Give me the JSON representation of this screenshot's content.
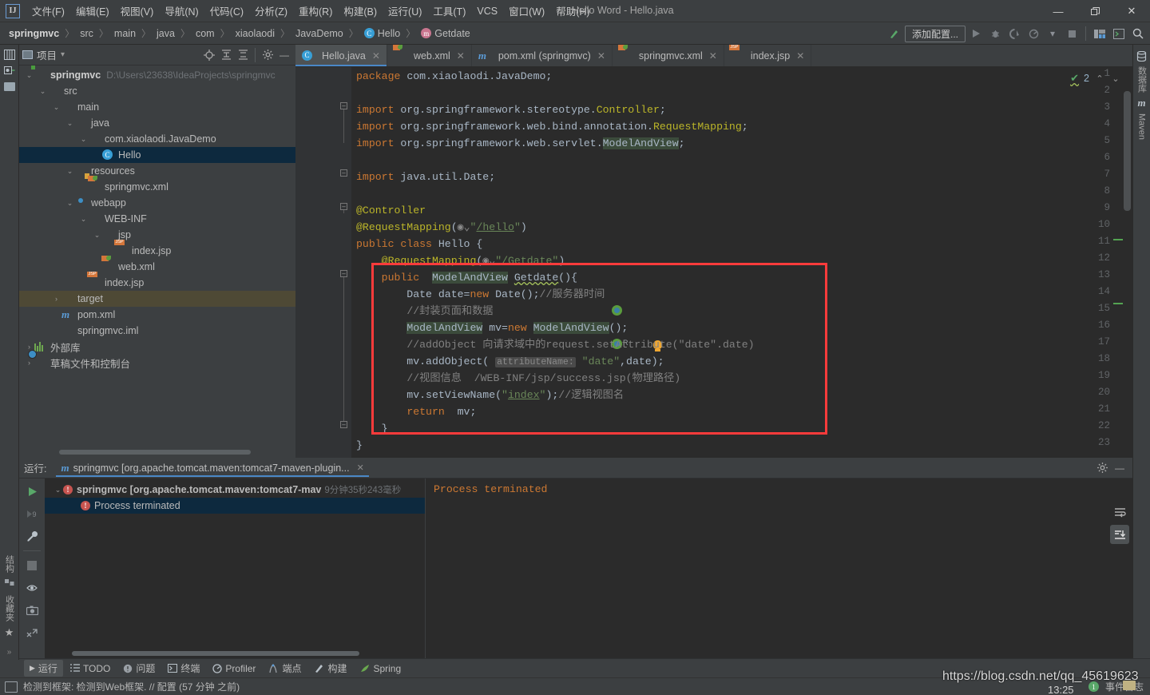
{
  "window": {
    "title": "Hello Word - Hello.java",
    "minimize": "—",
    "maximize": "❐",
    "close": "✕"
  },
  "menu": {
    "logo": "IJ",
    "items": [
      "文件(F)",
      "编辑(E)",
      "视图(V)",
      "导航(N)",
      "代码(C)",
      "分析(Z)",
      "重构(R)",
      "构建(B)",
      "运行(U)",
      "工具(T)",
      "VCS",
      "窗口(W)",
      "帮助(H)"
    ]
  },
  "breadcrumb": {
    "separator": "〉",
    "items": [
      {
        "label": "springmvc",
        "bold": true,
        "badge": ""
      },
      {
        "label": "src",
        "bold": false,
        "badge": ""
      },
      {
        "label": "main",
        "bold": false,
        "badge": ""
      },
      {
        "label": "java",
        "bold": false,
        "badge": ""
      },
      {
        "label": "com",
        "bold": false,
        "badge": ""
      },
      {
        "label": "xiaolaodi",
        "bold": false,
        "badge": ""
      },
      {
        "label": "JavaDemo",
        "bold": false,
        "badge": ""
      },
      {
        "label": "Hello",
        "bold": false,
        "badge": "C"
      },
      {
        "label": "Getdate",
        "bold": false,
        "badge": "m"
      }
    ]
  },
  "nav_toolbar": {
    "build_icon": "build-hammer-icon",
    "add_config_label": "添加配置...",
    "run_icon": "▶",
    "debug_icon": "debug-bug-icon",
    "coverage_icon": "coverage-icon",
    "profile_icon": "profiler-icon",
    "dropdown_icon": "▾",
    "stop_icon": "■",
    "layout_icon": "layout-icon",
    "terminal_icon": "terminal-icon",
    "search_icon": "⌕"
  },
  "left_strip": {
    "project_icon": "project-window-icon",
    "commit_icon": "commit-icon",
    "folder_icon": "folder-icon",
    "structure_label": "结构",
    "bookmarks_icon": "bookmarks-icon",
    "favorites_label": "收藏夹",
    "star_icon": "★"
  },
  "right_strip": {
    "database_label": "数据库",
    "database_icon": "database-icon",
    "maven_label": "Maven",
    "maven_icon": "m"
  },
  "project_panel": {
    "title": "项目",
    "dropdown": "▾",
    "icons": {
      "locate": "target-icon",
      "expand": "expand-all-icon",
      "collapse": "collapse-all-icon",
      "settings": "gear-icon",
      "hide": "—"
    },
    "tree": [
      {
        "depth": 0,
        "arrow": "⌄",
        "icon": "module-folder-icon",
        "label": "springmvc",
        "bold": true,
        "path": "D:\\Users\\23638\\IdeaProjects\\springmvc",
        "state": "normal"
      },
      {
        "depth": 1,
        "arrow": "⌄",
        "icon": "folder-icon",
        "label": "src",
        "bold": false,
        "path": "",
        "state": "normal"
      },
      {
        "depth": 2,
        "arrow": "⌄",
        "icon": "folder-icon",
        "label": "main",
        "bold": false,
        "path": "",
        "state": "normal"
      },
      {
        "depth": 3,
        "arrow": "⌄",
        "icon": "source-folder-icon",
        "label": "java",
        "bold": false,
        "path": "",
        "state": "normal"
      },
      {
        "depth": 4,
        "arrow": "⌄",
        "icon": "package-icon",
        "label": "com.xiaolaodi.JavaDemo",
        "bold": false,
        "path": "",
        "state": "normal"
      },
      {
        "depth": 5,
        "arrow": "",
        "icon": "class-icon",
        "label": "Hello",
        "bold": false,
        "path": "",
        "state": "selected"
      },
      {
        "depth": 3,
        "arrow": "⌄",
        "icon": "resources-folder-icon",
        "label": "resources",
        "bold": false,
        "path": "",
        "state": "normal"
      },
      {
        "depth": 4,
        "arrow": "",
        "icon": "spring-xml-icon",
        "label": "springmvc.xml",
        "bold": false,
        "path": "",
        "state": "normal"
      },
      {
        "depth": 3,
        "arrow": "⌄",
        "icon": "webapp-folder-icon",
        "label": "webapp",
        "bold": false,
        "path": "",
        "state": "normal"
      },
      {
        "depth": 4,
        "arrow": "⌄",
        "icon": "folder-icon",
        "label": "WEB-INF",
        "bold": false,
        "path": "",
        "state": "normal"
      },
      {
        "depth": 5,
        "arrow": "⌄",
        "icon": "folder-icon",
        "label": "jsp",
        "bold": false,
        "path": "",
        "state": "normal"
      },
      {
        "depth": 6,
        "arrow": "",
        "icon": "jsp-file-icon",
        "label": "index.jsp",
        "bold": false,
        "path": "",
        "state": "normal"
      },
      {
        "depth": 5,
        "arrow": "",
        "icon": "spring-xml-icon",
        "label": "web.xml",
        "bold": false,
        "path": "",
        "state": "normal"
      },
      {
        "depth": 4,
        "arrow": "",
        "icon": "jsp-file-icon",
        "label": "index.jsp",
        "bold": false,
        "path": "",
        "state": "normal"
      },
      {
        "depth": 2,
        "arrow": "›",
        "icon": "target-folder-icon",
        "label": "target",
        "bold": false,
        "path": "",
        "state": "amber"
      },
      {
        "depth": 2,
        "arrow": "",
        "icon": "maven-pom-icon",
        "label": "pom.xml",
        "bold": false,
        "path": "",
        "state": "normal"
      },
      {
        "depth": 2,
        "arrow": "",
        "icon": "iml-file-icon",
        "label": "springmvc.iml",
        "bold": false,
        "path": "",
        "state": "normal"
      },
      {
        "depth": 0,
        "arrow": "›",
        "icon": "library-icon",
        "label": "外部库",
        "bold": false,
        "path": "",
        "state": "normal"
      },
      {
        "depth": 0,
        "arrow": "›",
        "icon": "scratches-icon",
        "label": "草稿文件和控制台",
        "bold": false,
        "path": "",
        "state": "normal"
      }
    ]
  },
  "editor": {
    "tabs": [
      {
        "label": "Hello.java",
        "icon": "class-icon",
        "active": true,
        "close": "✕"
      },
      {
        "label": "web.xml",
        "icon": "spring-xml-icon",
        "active": false,
        "close": "✕"
      },
      {
        "label": "pom.xml (springmvc)",
        "icon": "maven-pom-icon",
        "active": false,
        "close": "✕"
      },
      {
        "label": "springmvc.xml",
        "icon": "spring-xml-icon",
        "active": false,
        "close": "✕"
      },
      {
        "label": "index.jsp",
        "icon": "jsp-file-icon",
        "active": false,
        "close": "✕"
      }
    ],
    "inspection": {
      "check_icon": "✔",
      "count": "2",
      "up_arrow": "⌃",
      "down_arrow": "⌄"
    },
    "line_numbers": [
      "1",
      "2",
      "3",
      "4",
      "5",
      "6",
      "7",
      "8",
      "9",
      "10",
      "11",
      "12",
      "13",
      "14",
      "15",
      "16",
      "17",
      "18",
      "19",
      "20",
      "21",
      "22",
      "23"
    ],
    "lines": [
      "package com.xiaolaodi.JavaDemo;",
      "",
      "import org.springframework.stereotype.Controller;",
      "import org.springframework.web.bind.annotation.RequestMapping;",
      "import org.springframework.web.servlet.ModelAndView;",
      "",
      "import java.util.Date;",
      "",
      "@Controller",
      "@RequestMapping(\"/hello\")",
      "public class Hello {",
      "    @RequestMapping(\"/Getdate\")",
      "    public  ModelAndView Getdate(){",
      "        Date date=new Date();//服务器时间",
      "        //封装页面和数据",
      "        ModelAndView mv=new ModelAndView();",
      "        //addObject 向请求域中的request.setAttribute(\"date\".date)",
      "        mv.addObject( attributeName: \"date\",date);",
      "        //视图信息  /WEB-INF/jsp/success.jsp(物理路径)",
      "        mv.setViewName(\"index\");//逻辑视图名",
      "        return  mv;",
      "    }",
      "}"
    ],
    "param_hint": "attributeName:"
  },
  "run_window": {
    "label": "运行:",
    "tab_icon": "maven-m-icon",
    "tab_label": "springmvc [org.apache.tomcat.maven:tomcat7-maven-plugin...",
    "tab_close": "✕",
    "settings_icon": "gear-icon",
    "hide_icon": "—",
    "sidebar_icons": {
      "rerun": "▶",
      "rerun_failed": "rerun-failed-icon",
      "settings": "wrench-icon",
      "stop": "■",
      "eye": "eye-icon",
      "camera": "camera-icon",
      "export": "export-icon"
    },
    "tree": [
      {
        "arrow": "⌄",
        "label": "springmvc [org.apache.tomcat.maven:tomcat7-mav",
        "time": "9分钟35秒243毫秒",
        "bold": true,
        "selected": false,
        "indent": 0
      },
      {
        "arrow": "",
        "label": "Process terminated",
        "time": "",
        "bold": false,
        "selected": true,
        "indent": 1
      }
    ],
    "output": "Process terminated",
    "right_icons": {
      "wrap": "soft-wrap-icon",
      "scroll_end": "scroll-to-end-icon"
    }
  },
  "tool_buttons": [
    {
      "icon": "▶",
      "label": "运行",
      "active": true
    },
    {
      "icon": "todo-list-icon",
      "label": "TODO",
      "active": false
    },
    {
      "icon": "problems-icon",
      "label": "问题",
      "active": false
    },
    {
      "icon": "terminal-icon",
      "label": "终端",
      "active": false
    },
    {
      "icon": "profiler-icon",
      "label": "Profiler",
      "active": false
    },
    {
      "icon": "endpoints-icon",
      "label": "端点",
      "active": false
    },
    {
      "icon": "build-hammer-icon",
      "label": "构建",
      "active": false
    },
    {
      "icon": "spring-leaf-icon",
      "label": "Spring",
      "active": false
    }
  ],
  "status_bar": {
    "icon": "memory-indicator-icon",
    "message": "检测到框架: 检测到Web框架. // 配置 (57 分钟 之前)",
    "event_badge": "1",
    "event_log": "事件日志"
  },
  "watermark": {
    "url": "https://blog.csdn.net/qq_45619623",
    "time": "13:25"
  },
  "colors": {
    "accent_blue": "#4a88c7",
    "selection": "#0d293e",
    "amber_row": "#4e4935",
    "error_red": "#c75450",
    "highlight_box": "#fb3b3b",
    "keyword": "#cc7832",
    "string": "#6a8759",
    "annotation": "#bbb529",
    "comment": "#808080",
    "editor_bg": "#2b2b2b",
    "panel_bg": "#3c3f41"
  }
}
